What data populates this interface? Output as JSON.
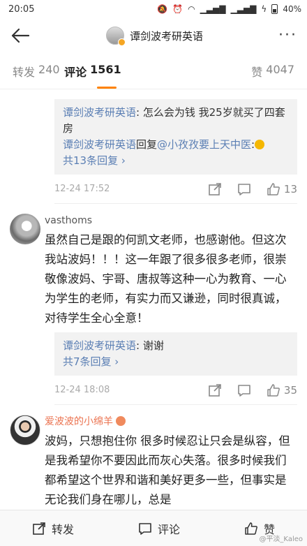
{
  "status": {
    "time": "20:05",
    "battery": "40%"
  },
  "nav": {
    "title": "谭剑波考研英语"
  },
  "tabs": [
    {
      "label": "转发",
      "count": "240"
    },
    {
      "label": "评论",
      "count": "1561"
    },
    {
      "label": "赞",
      "count": "4047"
    }
  ],
  "comments": [
    {
      "replies": [
        {
          "name": "谭剑波考研英语",
          "text": ": 怎么会为钱 我25岁就买了四套房"
        },
        {
          "name": "谭剑波考研英语",
          "mid": "回复",
          "target": "@小孜孜要上天中医",
          "text": ":"
        }
      ],
      "more_replies": "共13条回复 ›",
      "time": "12-24 17:52",
      "likes": "13"
    },
    {
      "user": "vasthoms",
      "text": "虽然自己是跟的何凯文老师，也感谢他。但这次我站波妈！！！这一年跟了很多很多老师，很崇敬像波妈、宇哥、唐叔等这种一心为教育、一心为学生的老师，有实力而又谦逊，同时很真诚，对待学生全心全意！",
      "replies": [
        {
          "name": "谭剑波考研英语",
          "text": ": 谢谢"
        }
      ],
      "more_replies": "共7条回复 ›",
      "time": "12-24 18:08",
      "likes": "35"
    },
    {
      "user": "爱波波的小绵羊",
      "text": "波妈，只想抱住你 很多时候忍让只会是纵容，但是我希望你不要因此而灰心失落。很多时候我们都希望这个世界和谐和美好更多一些，但事实是无论我们身在哪儿，总是"
    }
  ],
  "bottom": {
    "repost": "转发",
    "comment": "评论",
    "like": "赞"
  },
  "watermark": "@平淡_Kaleo",
  "colors": {
    "accent": "#ff8200",
    "link": "#5b7fb4",
    "username_orange": "#eb7350"
  }
}
